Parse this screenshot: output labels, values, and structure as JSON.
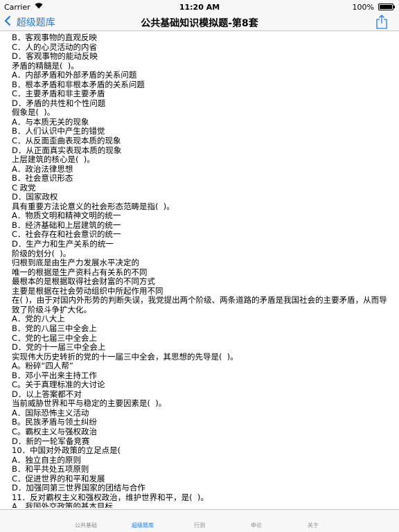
{
  "status": {
    "carrier": "Carrier",
    "wifi_icon": "wifi-icon",
    "time": "11:20 AM",
    "battery": "100%"
  },
  "nav": {
    "back_label": "超级题库",
    "title": "公共基础知识模拟题-第8套",
    "share_icon": "share-icon",
    "accent_color": "#1a7cf5"
  },
  "content": {
    "lines": [
      "B．客观事物的直观反映",
      "C．人的心灵活动的内省",
      "D．客观事物的能动反映",
      "矛盾的精髓是(  )。",
      "A．内部矛盾和外部矛盾的关系问题",
      "B．根本矛盾和非根本矛盾的关系问题",
      "C．主要矛盾和非主要矛盾",
      "D．矛盾的共性和个性问题",
      "假象是(  )。",
      "A．与本质无关的现象",
      "B．人们认识中产生的错觉",
      "C．从反面歪曲表现本质的现象",
      "D．从正面真实表现本质的现象",
      "上层建筑的核心是(  )。",
      "A．政治法律思想",
      "B．社会意识形态",
      "C 政党",
      "D．国家政权",
      "具有重要方法论意义的社会形态范畴是指(  )。",
      "A．物质文明和精神文明的统一",
      "B．经济基础和上层建筑的统一",
      "C．社会存在和社会意识的统一",
      "D．生产力和生产关系的统一",
      "阶级的划分(  )。",
      "归根到底是由生产力发展水平决定的",
      "唯一的根据是生产资料占有关系的不同",
      "最根本的是根据取得社会财富的不同方式",
      "主要是根据在社会劳动组织中所起作用不同",
      "在(  )，由于对国内外形势的判断失误，我党提出两个阶级、两条道路的矛盾是我国社会的主要矛盾，从而导致了阶级斗争扩大化。",
      "A．党的八大上",
      "B．党的八届三中全会上",
      "C．党的七届三中全会上",
      "D．党的十一届三中全会上",
      "实现伟大历史转折的党的十一届三中全会，其思想的先导是(  )。",
      "A。粉碎“四人帮”",
      "B．邓小平出来主持工作",
      "C。关于真理标准的大讨论",
      "D．以上答案都不对",
      "当前威胁世界和平与稳定的主要因素是(  )。",
      "A．国际恐怖主义活动",
      "B。民族矛盾与领土纠纷",
      "C。霸权主义与强权政治",
      "D．新的一轮军备竞赛",
      "10．中国对外政策的立足点是(",
      "A．独立自主的原则",
      "B．和平共处五项原则",
      "C．促进世界的和平和发展",
      "D．加强同第三世界国家的团结与合作",
      "11．反对霸权主义和强权政治，维护世界和平，是(  )。",
      "A．我国外交政策的基本目标"
    ]
  },
  "tabs": [
    {
      "label": "公共基础",
      "active": false
    },
    {
      "label": "超级题库",
      "active": true
    },
    {
      "label": "行测",
      "active": false
    },
    {
      "label": "申论",
      "active": false
    },
    {
      "label": "关于",
      "active": false
    }
  ]
}
